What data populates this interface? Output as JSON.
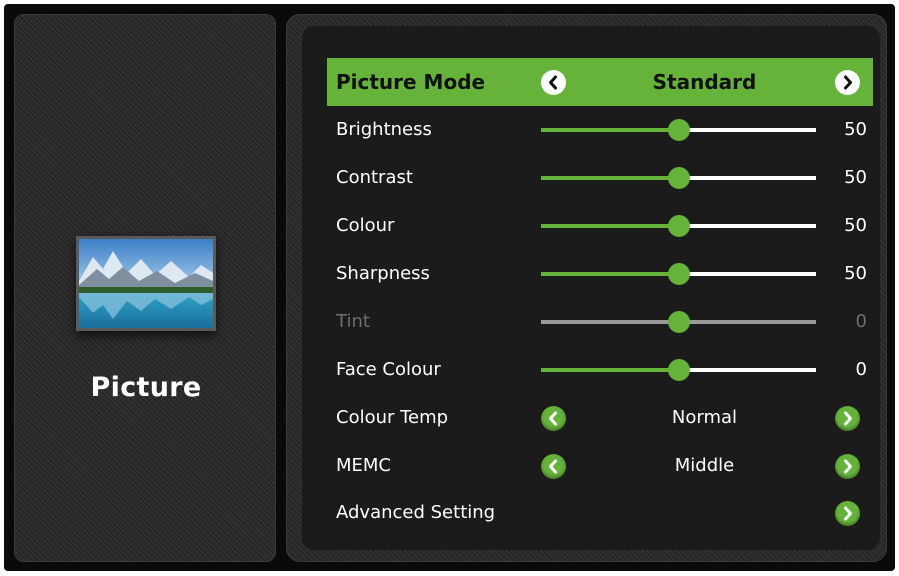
{
  "category": {
    "title": "Picture",
    "icon": "landscape-thumbnail"
  },
  "colors": {
    "accent": "#66b33a",
    "panel": "#1b1b1b",
    "disabled": "#6e6e6e"
  },
  "menu": {
    "picture_mode": {
      "label": "Picture Mode",
      "value": "Standard"
    },
    "brightness": {
      "label": "Brightness",
      "value": "50",
      "level": 0.5
    },
    "contrast": {
      "label": "Contrast",
      "value": "50",
      "level": 0.5
    },
    "colour": {
      "label": "Colour",
      "value": "50",
      "level": 0.5
    },
    "sharpness": {
      "label": "Sharpness",
      "value": "50",
      "level": 0.5
    },
    "tint": {
      "label": "Tint",
      "value": "0",
      "level": 0.5,
      "disabled": true
    },
    "face_colour": {
      "label": "Face Colour",
      "value": "0",
      "level": 0.5
    },
    "colour_temp": {
      "label": "Colour Temp",
      "value": "Normal"
    },
    "memc": {
      "label": "MEMC",
      "value": "Middle"
    },
    "advanced_setting": {
      "label": "Advanced Setting"
    }
  },
  "icons": {
    "left_arrow": "chevron-left-icon",
    "right_arrow": "chevron-right-icon"
  }
}
